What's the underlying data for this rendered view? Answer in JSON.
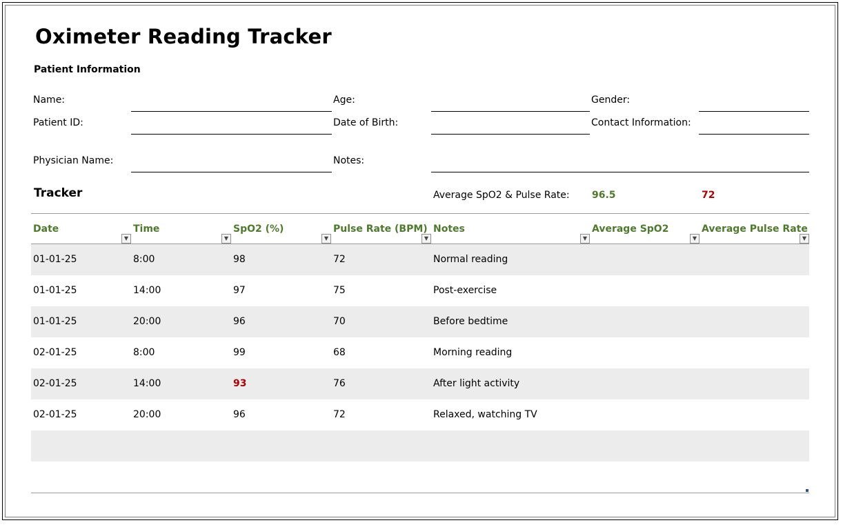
{
  "title": "Oximeter Reading Tracker",
  "patient_info": {
    "heading": "Patient Information",
    "name_label": "Name:",
    "name_value": "",
    "age_label": "Age:",
    "age_value": "",
    "gender_label": "Gender:",
    "gender_value": "",
    "patient_id_label": "Patient ID:",
    "patient_id_value": "",
    "dob_label": "Date of Birth:",
    "dob_value": "",
    "contact_label": "Contact Information:",
    "contact_value": "",
    "physician_label": "Physician Name:",
    "physician_value": "",
    "notes_label": "Notes:",
    "notes_value": ""
  },
  "tracker": {
    "heading": "Tracker",
    "average_label": "Average SpO2 & Pulse Rate:",
    "average_spo2": "96.5",
    "average_pulse": "72"
  },
  "table": {
    "columns": [
      "Date",
      "Time",
      "SpO2 (%)",
      "Pulse Rate (BPM)",
      "Notes",
      "Average SpO2",
      "Average Pulse Rate"
    ],
    "rows": [
      [
        "01-01-25",
        "8:00",
        "98",
        "72",
        "Normal reading",
        "",
        ""
      ],
      [
        "01-01-25",
        "14:00",
        "97",
        "75",
        "Post-exercise",
        "",
        ""
      ],
      [
        "01-01-25",
        "20:00",
        "96",
        "70",
        "Before bedtime",
        "",
        ""
      ],
      [
        "02-01-25",
        "8:00",
        "99",
        "68",
        "Morning reading",
        "",
        ""
      ],
      [
        "02-01-25",
        "14:00",
        "93",
        "76",
        "After light activity",
        "",
        ""
      ],
      [
        "02-01-25",
        "20:00",
        "96",
        "72",
        "Relaxed, watching TV",
        "",
        ""
      ],
      [
        "",
        "",
        "",
        "",
        "",
        "",
        ""
      ],
      [
        "",
        "",
        "",
        "",
        "",
        "",
        ""
      ]
    ],
    "filter_icon": "dropdown-arrow-icon"
  },
  "colors": {
    "header_text": "#4e7a2c",
    "alert_text": "#b00000",
    "band_fill": "#ececec"
  }
}
